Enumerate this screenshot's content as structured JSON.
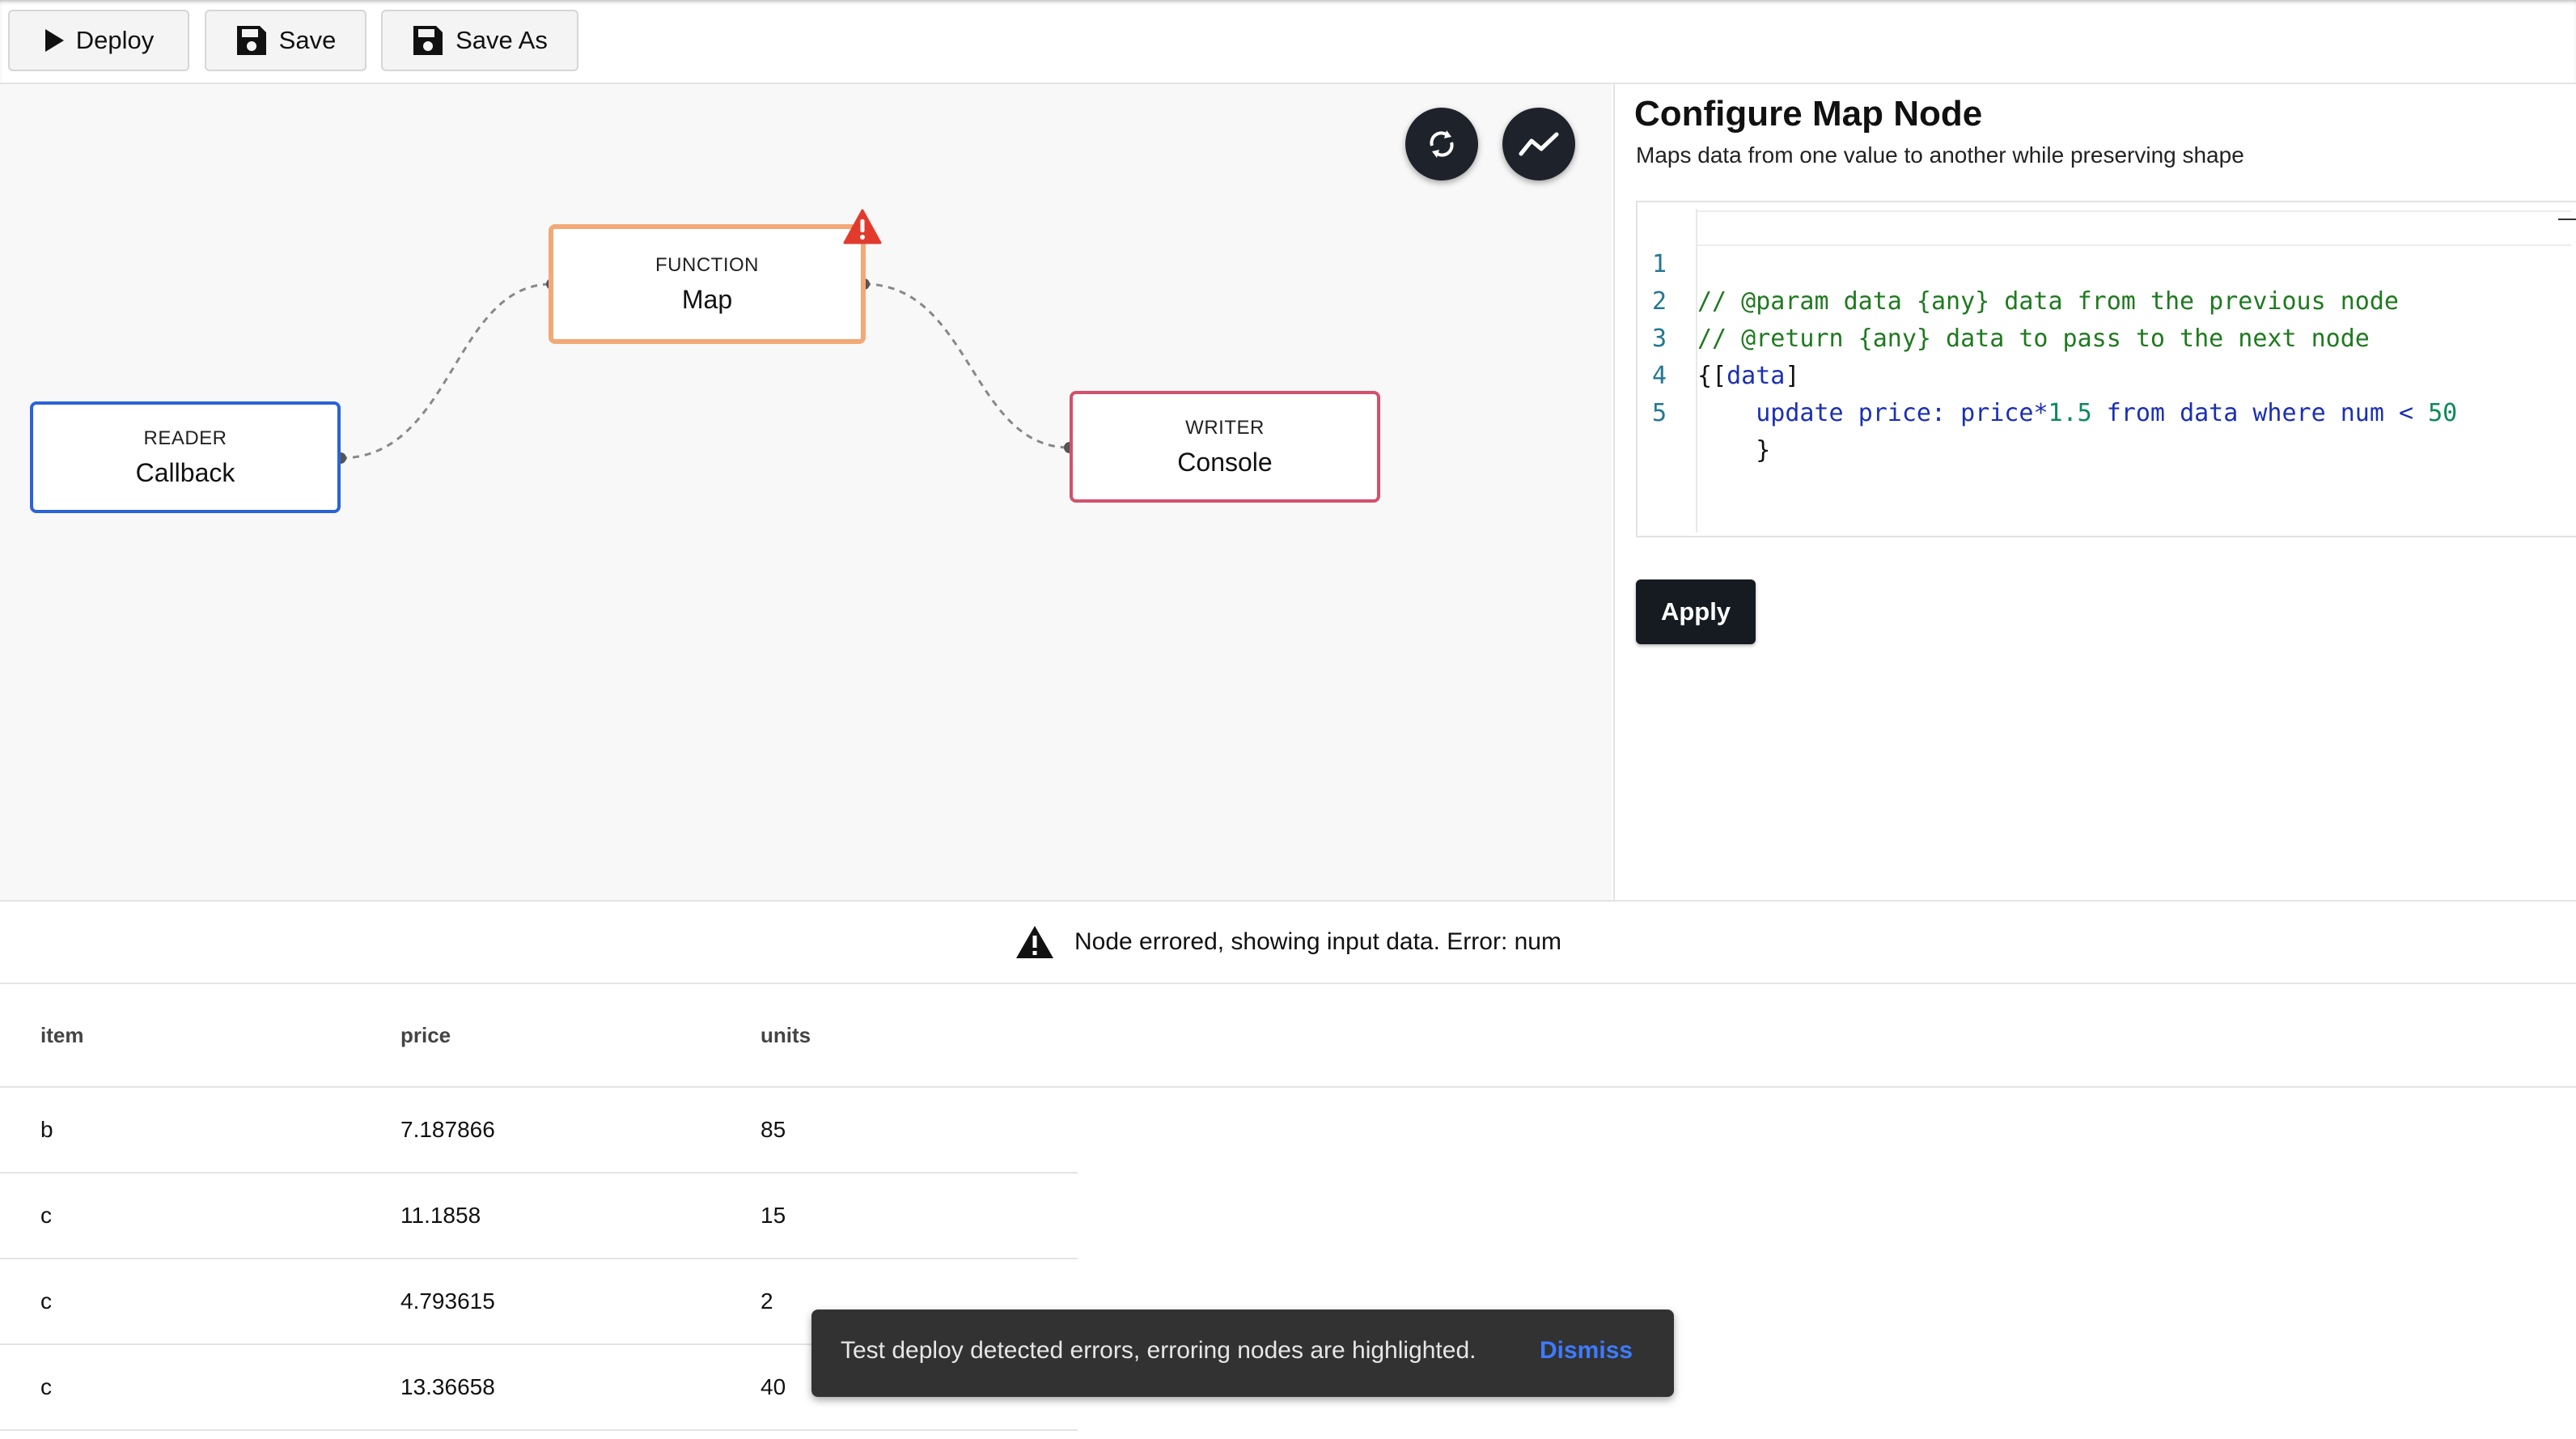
{
  "toolbar": {
    "deploy_label": "Deploy",
    "save_label": "Save",
    "save_as_label": "Save As"
  },
  "canvas": {
    "fab_refresh_icon": "refresh-icon",
    "fab_trend_icon": "trend-icon",
    "nodes": {
      "reader": {
        "type": "READER",
        "name": "Callback",
        "color": "#2a63d9"
      },
      "map": {
        "type": "FUNCTION",
        "name": "Map",
        "color": "#f2a977",
        "status": "error"
      },
      "writer": {
        "type": "WRITER",
        "name": "Console",
        "color": "#d4506b"
      }
    }
  },
  "panel": {
    "title": "Configure Map Node",
    "subtitle": "Maps data from one value to another while preserving shape",
    "code_lines": [
      {
        "num": "1",
        "text": "// @param data {any} data from the previous node"
      },
      {
        "num": "2",
        "text": "// @return {any} data to pass to the next node"
      },
      {
        "num": "3",
        "text": "{[data]"
      },
      {
        "num": "4",
        "text": "    update price: price*1.5 from data where num < 50"
      },
      {
        "num": "5",
        "text": "    }"
      }
    ],
    "apply_label": "Apply"
  },
  "error_bar": {
    "icon": "warning-icon",
    "text": "Node errored, showing input data. Error: num"
  },
  "table": {
    "columns": [
      "item",
      "price",
      "units"
    ],
    "rows": [
      [
        "b",
        "7.187866",
        "85"
      ],
      [
        "c",
        "11.1858",
        "15"
      ],
      [
        "c",
        "4.793615",
        "2"
      ],
      [
        "c",
        "13.36658",
        "40"
      ]
    ]
  },
  "snackbar": {
    "message": "Test deploy detected errors, erroring nodes are highlighted.",
    "action_label": "Dismiss",
    "action_color": "#3d7bff"
  }
}
